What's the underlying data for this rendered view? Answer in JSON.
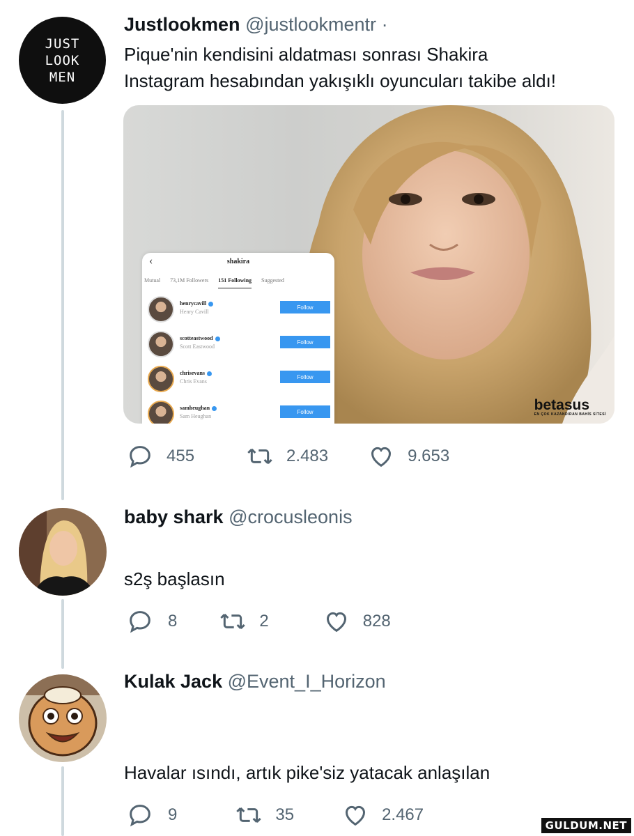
{
  "main_tweet": {
    "avatar_logo": [
      "JUST",
      "LOOK",
      "MEN"
    ],
    "name": "Justlookmen",
    "handle": "@justlookmentr",
    "dot": "·",
    "text_line1": "Pique'nin kendisini aldatması sonrası Shakira",
    "text_line2": "Instagram hesabından yakışıklı oyuncuları takibe aldı!",
    "media": {
      "instagram": {
        "title": "shakira",
        "tabs": [
          "Mutual",
          "73,1M Followers",
          "151 Following",
          "Suggested"
        ],
        "active_tab": "151 Following",
        "rows": [
          {
            "username": "henrycavill",
            "fullname": "Henry Cavill",
            "button": "Follow"
          },
          {
            "username": "scotteastwood",
            "fullname": "Scott Eastwood",
            "button": "Follow"
          },
          {
            "username": "chrisevans",
            "fullname": "Chris Evans",
            "button": "Follow"
          },
          {
            "username": "samheughan",
            "fullname": "Sam Heughan",
            "button": "Follow"
          }
        ]
      },
      "watermark": "betasus",
      "watermark_sub": "EN ÇOK KAZANDIRAN BAHİS SİTESİ"
    },
    "replies": "455",
    "retweets": "2.483",
    "likes": "9.653"
  },
  "reply1": {
    "name": "baby shark",
    "handle": "@crocusleonis",
    "text": "s2ş başlasın",
    "replies": "8",
    "retweets": "2",
    "likes": "828"
  },
  "reply2": {
    "name": "Kulak Jack",
    "handle": "@Event_I_Horizon",
    "text": "Havalar ısındı, artık pike'siz yatacak anlaşılan",
    "replies": "9",
    "retweets": "35",
    "likes": "2.467"
  },
  "corner_watermark": "GULDUM.NET"
}
